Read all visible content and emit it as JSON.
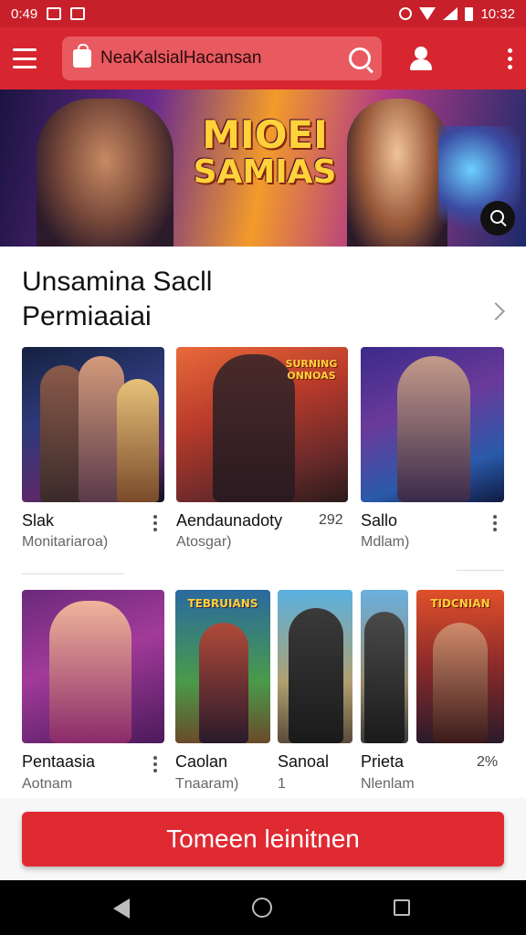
{
  "status_bar": {
    "time_left": "0:49",
    "time_right": "10:32",
    "icons": [
      "image-icon",
      "notification-icon",
      "alarm-icon",
      "wifi-icon",
      "signal-icon",
      "battery-icon"
    ]
  },
  "app_bar": {
    "search_value": "NeaKalsialHacansan",
    "icons": [
      "menu-icon",
      "shopping-bag-icon",
      "search-icon",
      "account-icon",
      "more-vert-icon"
    ],
    "color": "#d7262f"
  },
  "hero": {
    "title_line1": "MIOEI",
    "title_line2": "SAMIAS"
  },
  "section": {
    "title_line1": "Unsamina Sacll",
    "title_line2": "Permiaaiai"
  },
  "row1": [
    {
      "title": "Slak",
      "subtitle": "Monitariaroa)",
      "meta": ""
    },
    {
      "title": "Aendaunadoty",
      "subtitle": "Atosgar)",
      "meta": "292"
    },
    {
      "title": "Sallo",
      "subtitle": "Mdlam)",
      "meta": ""
    }
  ],
  "row2": [
    {
      "title": "Pentaasia",
      "subtitle": "Aotnam",
      "meta": "",
      "banner": ""
    },
    {
      "title": "Caolan",
      "subtitle": "Tnaaram)",
      "meta": "",
      "banner": "TEBRUIANS"
    },
    {
      "title": "Sanoal",
      "subtitle": "1",
      "meta": "",
      "banner": ""
    },
    {
      "title": "Prieta",
      "subtitle": "Nlenlam",
      "meta": "2%",
      "banner": "TIDCNIAN"
    }
  ],
  "row1_banner": "SURNING ONNOAS",
  "cta": {
    "label": "Tomeen leinitnen",
    "color": "#e02a32"
  },
  "nav_bar": {
    "icons": [
      "back-icon",
      "home-icon",
      "recents-icon"
    ]
  }
}
